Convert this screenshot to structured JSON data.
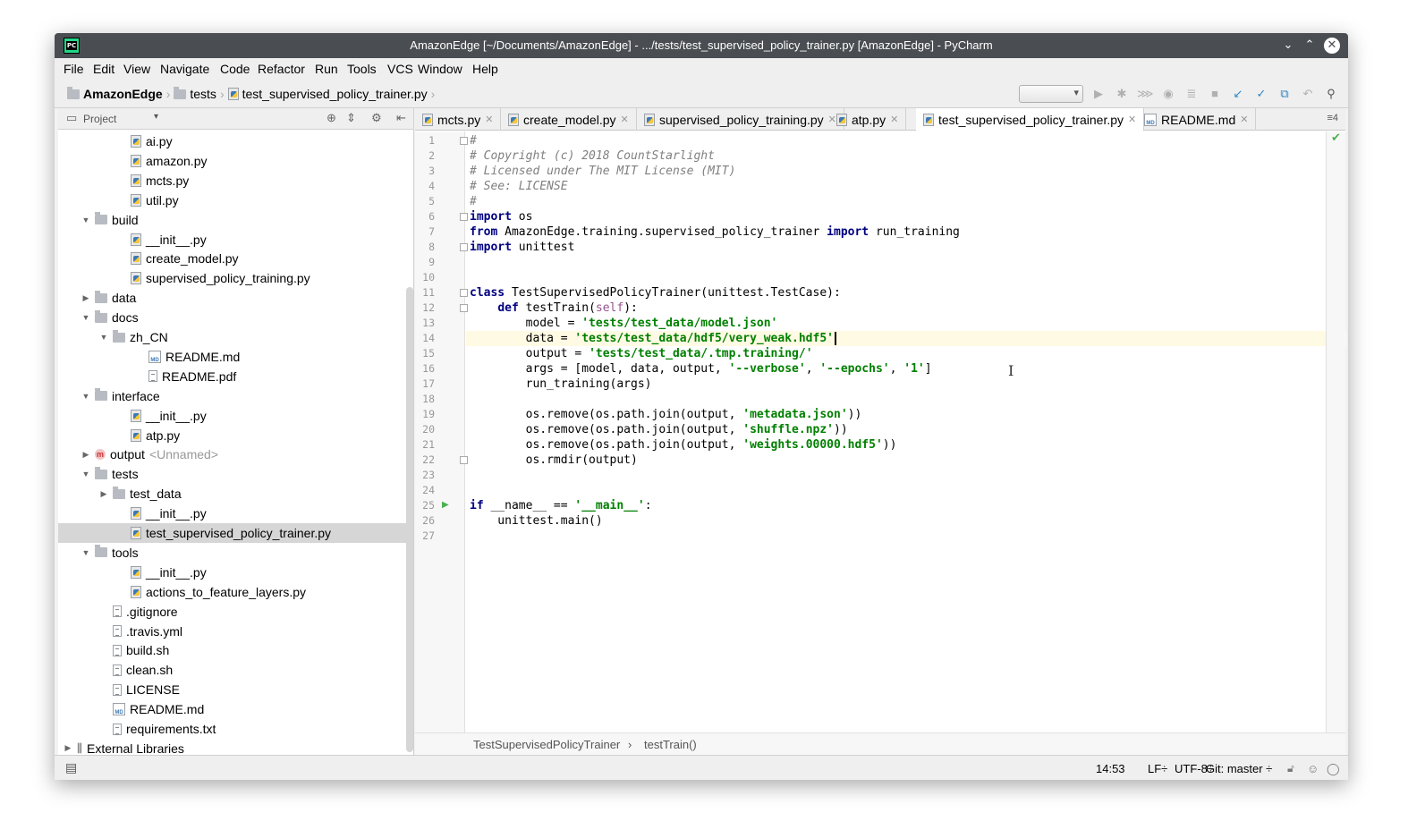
{
  "window": {
    "title": "AmazonEdge [~/Documents/AmazonEdge] - .../tests/test_supervised_policy_trainer.py [AmazonEdge] - PyCharm"
  },
  "menu": [
    "File",
    "Edit",
    "View",
    "Navigate",
    "Code",
    "Refactor",
    "Run",
    "Tools",
    "VCS",
    "Window",
    "Help"
  ],
  "breadcrumb": [
    "AmazonEdge",
    "tests",
    "test_supervised_policy_trainer.py"
  ],
  "project_panel": {
    "label": "Project",
    "tree": [
      {
        "name": "ai.py",
        "icon": "py",
        "level": 3
      },
      {
        "name": "amazon.py",
        "icon": "py",
        "level": 3
      },
      {
        "name": "mcts.py",
        "icon": "py",
        "level": 3
      },
      {
        "name": "util.py",
        "icon": "py",
        "level": 3
      },
      {
        "name": "build",
        "icon": "folder",
        "level": 1,
        "arrow": "open"
      },
      {
        "name": "__init__.py",
        "icon": "py",
        "level": 3
      },
      {
        "name": "create_model.py",
        "icon": "py",
        "level": 3
      },
      {
        "name": "supervised_policy_training.py",
        "icon": "py",
        "level": 3
      },
      {
        "name": "data",
        "icon": "folder",
        "level": 1,
        "arrow": "closed"
      },
      {
        "name": "docs",
        "icon": "folder",
        "level": 1,
        "arrow": "open"
      },
      {
        "name": "zh_CN",
        "icon": "folder",
        "level": 2,
        "arrow": "open"
      },
      {
        "name": "README.md",
        "icon": "md",
        "level": 4
      },
      {
        "name": "README.pdf",
        "icon": "txt",
        "level": 4
      },
      {
        "name": "interface",
        "icon": "folder",
        "level": 1,
        "arrow": "open"
      },
      {
        "name": "__init__.py",
        "icon": "py",
        "level": 3
      },
      {
        "name": "atp.py",
        "icon": "py",
        "level": 3
      },
      {
        "name": "output",
        "icon": "module",
        "level": 1,
        "arrow": "closed",
        "suffix": "<Unnamed>"
      },
      {
        "name": "tests",
        "icon": "folder",
        "level": 1,
        "arrow": "open"
      },
      {
        "name": "test_data",
        "icon": "folder",
        "level": 2,
        "arrow": "closed"
      },
      {
        "name": "__init__.py",
        "icon": "py",
        "level": 3
      },
      {
        "name": "test_supervised_policy_trainer.py",
        "icon": "py",
        "level": 3,
        "selected": true
      },
      {
        "name": "tools",
        "icon": "folder",
        "level": 1,
        "arrow": "open"
      },
      {
        "name": "__init__.py",
        "icon": "py",
        "level": 3
      },
      {
        "name": "actions_to_feature_layers.py",
        "icon": "py",
        "level": 3
      },
      {
        "name": ".gitignore",
        "icon": "txt",
        "level": 2
      },
      {
        "name": ".travis.yml",
        "icon": "txt",
        "level": 2
      },
      {
        "name": "build.sh",
        "icon": "txt",
        "level": 2
      },
      {
        "name": "clean.sh",
        "icon": "txt",
        "level": 2
      },
      {
        "name": "LICENSE",
        "icon": "txt",
        "level": 2
      },
      {
        "name": "README.md",
        "icon": "md",
        "level": 2
      },
      {
        "name": "requirements.txt",
        "icon": "txt",
        "level": 2
      },
      {
        "name": "External Libraries",
        "icon": "lib",
        "level": 0,
        "arrow": "closed"
      }
    ]
  },
  "tabs": [
    {
      "label": "mcts.py",
      "icon": "py"
    },
    {
      "label": "create_model.py",
      "icon": "py"
    },
    {
      "label": "supervised_policy_training.py",
      "icon": "py"
    },
    {
      "label": "atp.py",
      "icon": "py"
    },
    {
      "label": "test_supervised_policy_trainer.py",
      "icon": "py",
      "active": true
    },
    {
      "label": "README.md",
      "icon": "md"
    }
  ],
  "tab_overflow": "≡4",
  "code_lines": [
    [
      {
        "t": "#",
        "c": "cmt"
      }
    ],
    [
      {
        "t": "# Copyright (c) 2018 CountStarlight",
        "c": "cmt"
      }
    ],
    [
      {
        "t": "# Licensed under The MIT License (MIT)",
        "c": "cmt"
      }
    ],
    [
      {
        "t": "# See: LICENSE",
        "c": "cmt"
      }
    ],
    [
      {
        "t": "#",
        "c": "cmt"
      }
    ],
    [
      {
        "t": "import",
        "c": "kw"
      },
      {
        "t": " os",
        "c": ""
      }
    ],
    [
      {
        "t": "from",
        "c": "kw"
      },
      {
        "t": " AmazonEdge.training.supervised_policy_trainer ",
        "c": ""
      },
      {
        "t": "import",
        "c": "kw"
      },
      {
        "t": " run_training",
        "c": ""
      }
    ],
    [
      {
        "t": "import",
        "c": "kw"
      },
      {
        "t": " unittest",
        "c": ""
      }
    ],
    [],
    [],
    [
      {
        "t": "class",
        "c": "kw"
      },
      {
        "t": " TestSupervisedPolicyTrainer(unittest.TestCase):",
        "c": ""
      }
    ],
    [
      {
        "t": "    ",
        "c": ""
      },
      {
        "t": "def",
        "c": "kw"
      },
      {
        "t": " testTrain(",
        "c": ""
      },
      {
        "t": "self",
        "c": "slf"
      },
      {
        "t": "):",
        "c": ""
      }
    ],
    [
      {
        "t": "        model = ",
        "c": ""
      },
      {
        "t": "'tests/test_data/model.json'",
        "c": "str"
      }
    ],
    [
      {
        "t": "        data = ",
        "c": ""
      },
      {
        "t": "'tests/test_data/hdf5/very_weak.hdf5'",
        "c": "str"
      }
    ],
    [
      {
        "t": "        output = ",
        "c": ""
      },
      {
        "t": "'tests/test_data/.tmp.training/'",
        "c": "str"
      }
    ],
    [
      {
        "t": "        args = [model, data, output, ",
        "c": ""
      },
      {
        "t": "'--verbose'",
        "c": "str"
      },
      {
        "t": ", ",
        "c": ""
      },
      {
        "t": "'--epochs'",
        "c": "str"
      },
      {
        "t": ", ",
        "c": ""
      },
      {
        "t": "'1'",
        "c": "str"
      },
      {
        "t": "]",
        "c": ""
      }
    ],
    [
      {
        "t": "        run_training(args)",
        "c": ""
      }
    ],
    [],
    [
      {
        "t": "        os.remove(os.path.join(output, ",
        "c": ""
      },
      {
        "t": "'metadata.json'",
        "c": "str"
      },
      {
        "t": "))",
        "c": ""
      }
    ],
    [
      {
        "t": "        os.remove(os.path.join(output, ",
        "c": ""
      },
      {
        "t": "'shuffle.npz'",
        "c": "str"
      },
      {
        "t": "))",
        "c": ""
      }
    ],
    [
      {
        "t": "        os.remove(os.path.join(output, ",
        "c": ""
      },
      {
        "t": "'weights.00000.hdf5'",
        "c": "str"
      },
      {
        "t": "))",
        "c": ""
      }
    ],
    [
      {
        "t": "        os.rmdir(output)",
        "c": ""
      }
    ],
    [],
    [],
    [
      {
        "t": "if",
        "c": "kw"
      },
      {
        "t": " __name__ == ",
        "c": ""
      },
      {
        "t": "'__main__'",
        "c": "str"
      },
      {
        "t": ":",
        "c": ""
      }
    ],
    [
      {
        "t": "    unittest.main()",
        "c": ""
      }
    ],
    []
  ],
  "current_line": 14,
  "editor_breadcrumb": [
    "TestSupervisedPolicyTrainer",
    "testTrain()"
  ],
  "status": {
    "position": "14:53",
    "line_sep": "LF÷",
    "encoding": "UTF-8÷",
    "vcs": "Git: master ÷"
  }
}
